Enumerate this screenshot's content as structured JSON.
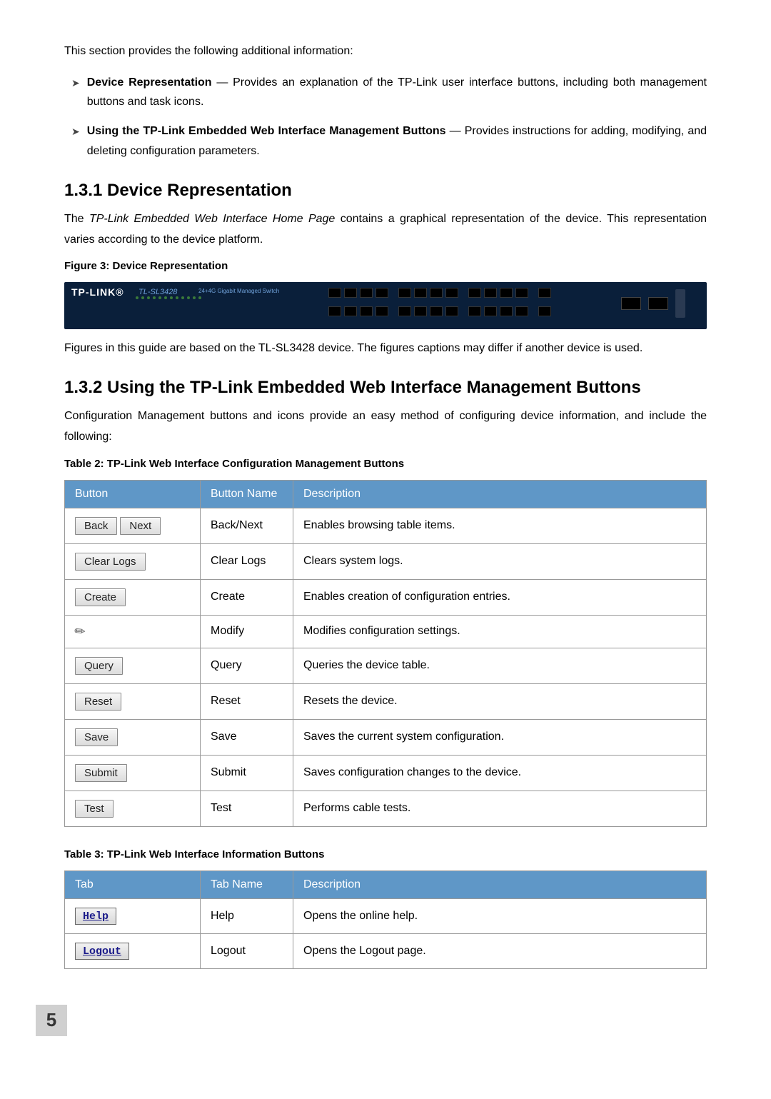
{
  "intro": "This section provides the following additional information:",
  "bullets": [
    {
      "title": "Device Representation",
      "dash": " — ",
      "body": "Provides an explanation of the TP-Link user interface buttons, including both management buttons and task icons."
    },
    {
      "title": "Using the TP-Link Embedded Web Interface Management Buttons",
      "dash": " — ",
      "body": "Provides instructions for adding, modifying, and deleting configuration parameters."
    }
  ],
  "s131": {
    "heading": "1.3.1  Device Representation",
    "para_a": "The ",
    "para_b": "TP-Link Embedded Web Interface Home Page",
    "para_c": " contains a graphical representation of the device. This representation varies according to the device platform.",
    "fig_caption": "Figure 3: Device Representation",
    "fig_brand": "TP-LINK®",
    "fig_model": "TL-SL3428",
    "fig_desc": "24+4G Gigabit Managed Switch",
    "note": "Figures in this guide are based on the TL-SL3428 device. The figures captions may differ if another device is used."
  },
  "s132": {
    "heading": "1.3.2  Using the TP-Link Embedded Web Interface Management Buttons",
    "para": "Configuration Management buttons and icons provide an easy method of configuring device information, and include the following:",
    "table2_caption": "Table 2: TP-Link Web Interface Configuration Management Buttons",
    "table2_headers": {
      "c1": "Button",
      "c2": "Button Name",
      "c3": "Description"
    },
    "table2_rows": [
      {
        "btn": [
          "Back",
          "Next"
        ],
        "name": "Back/Next",
        "desc": "Enables browsing table items."
      },
      {
        "btn": [
          "Clear Logs"
        ],
        "name": "Clear Logs",
        "desc": "Clears system logs."
      },
      {
        "btn": [
          "Create"
        ],
        "name": "Create",
        "desc": "Enables creation of configuration entries."
      },
      {
        "icon": "pencil",
        "name": "Modify",
        "desc": "Modifies configuration settings."
      },
      {
        "btn": [
          "Query"
        ],
        "name": "Query",
        "desc": "Queries the device table."
      },
      {
        "btn": [
          "Reset"
        ],
        "name": "Reset",
        "desc": "Resets the device."
      },
      {
        "btn": [
          "Save"
        ],
        "name": "Save",
        "desc": "Saves the current system configuration."
      },
      {
        "btn": [
          "Submit"
        ],
        "name": "Submit",
        "desc": "Saves configuration changes to the device."
      },
      {
        "btn": [
          "Test"
        ],
        "name": "Test",
        "desc": "Performs cable tests."
      }
    ],
    "table3_caption": "Table 3: TP-Link Web Interface Information Buttons",
    "table3_headers": {
      "c1": "Tab",
      "c2": "Tab Name",
      "c3": "Description"
    },
    "table3_rows": [
      {
        "link": "Help",
        "name": "Help",
        "desc": "Opens the online help."
      },
      {
        "link": "Logout",
        "name": "Logout",
        "desc": "Opens the Logout page."
      }
    ]
  },
  "page_number": "5"
}
